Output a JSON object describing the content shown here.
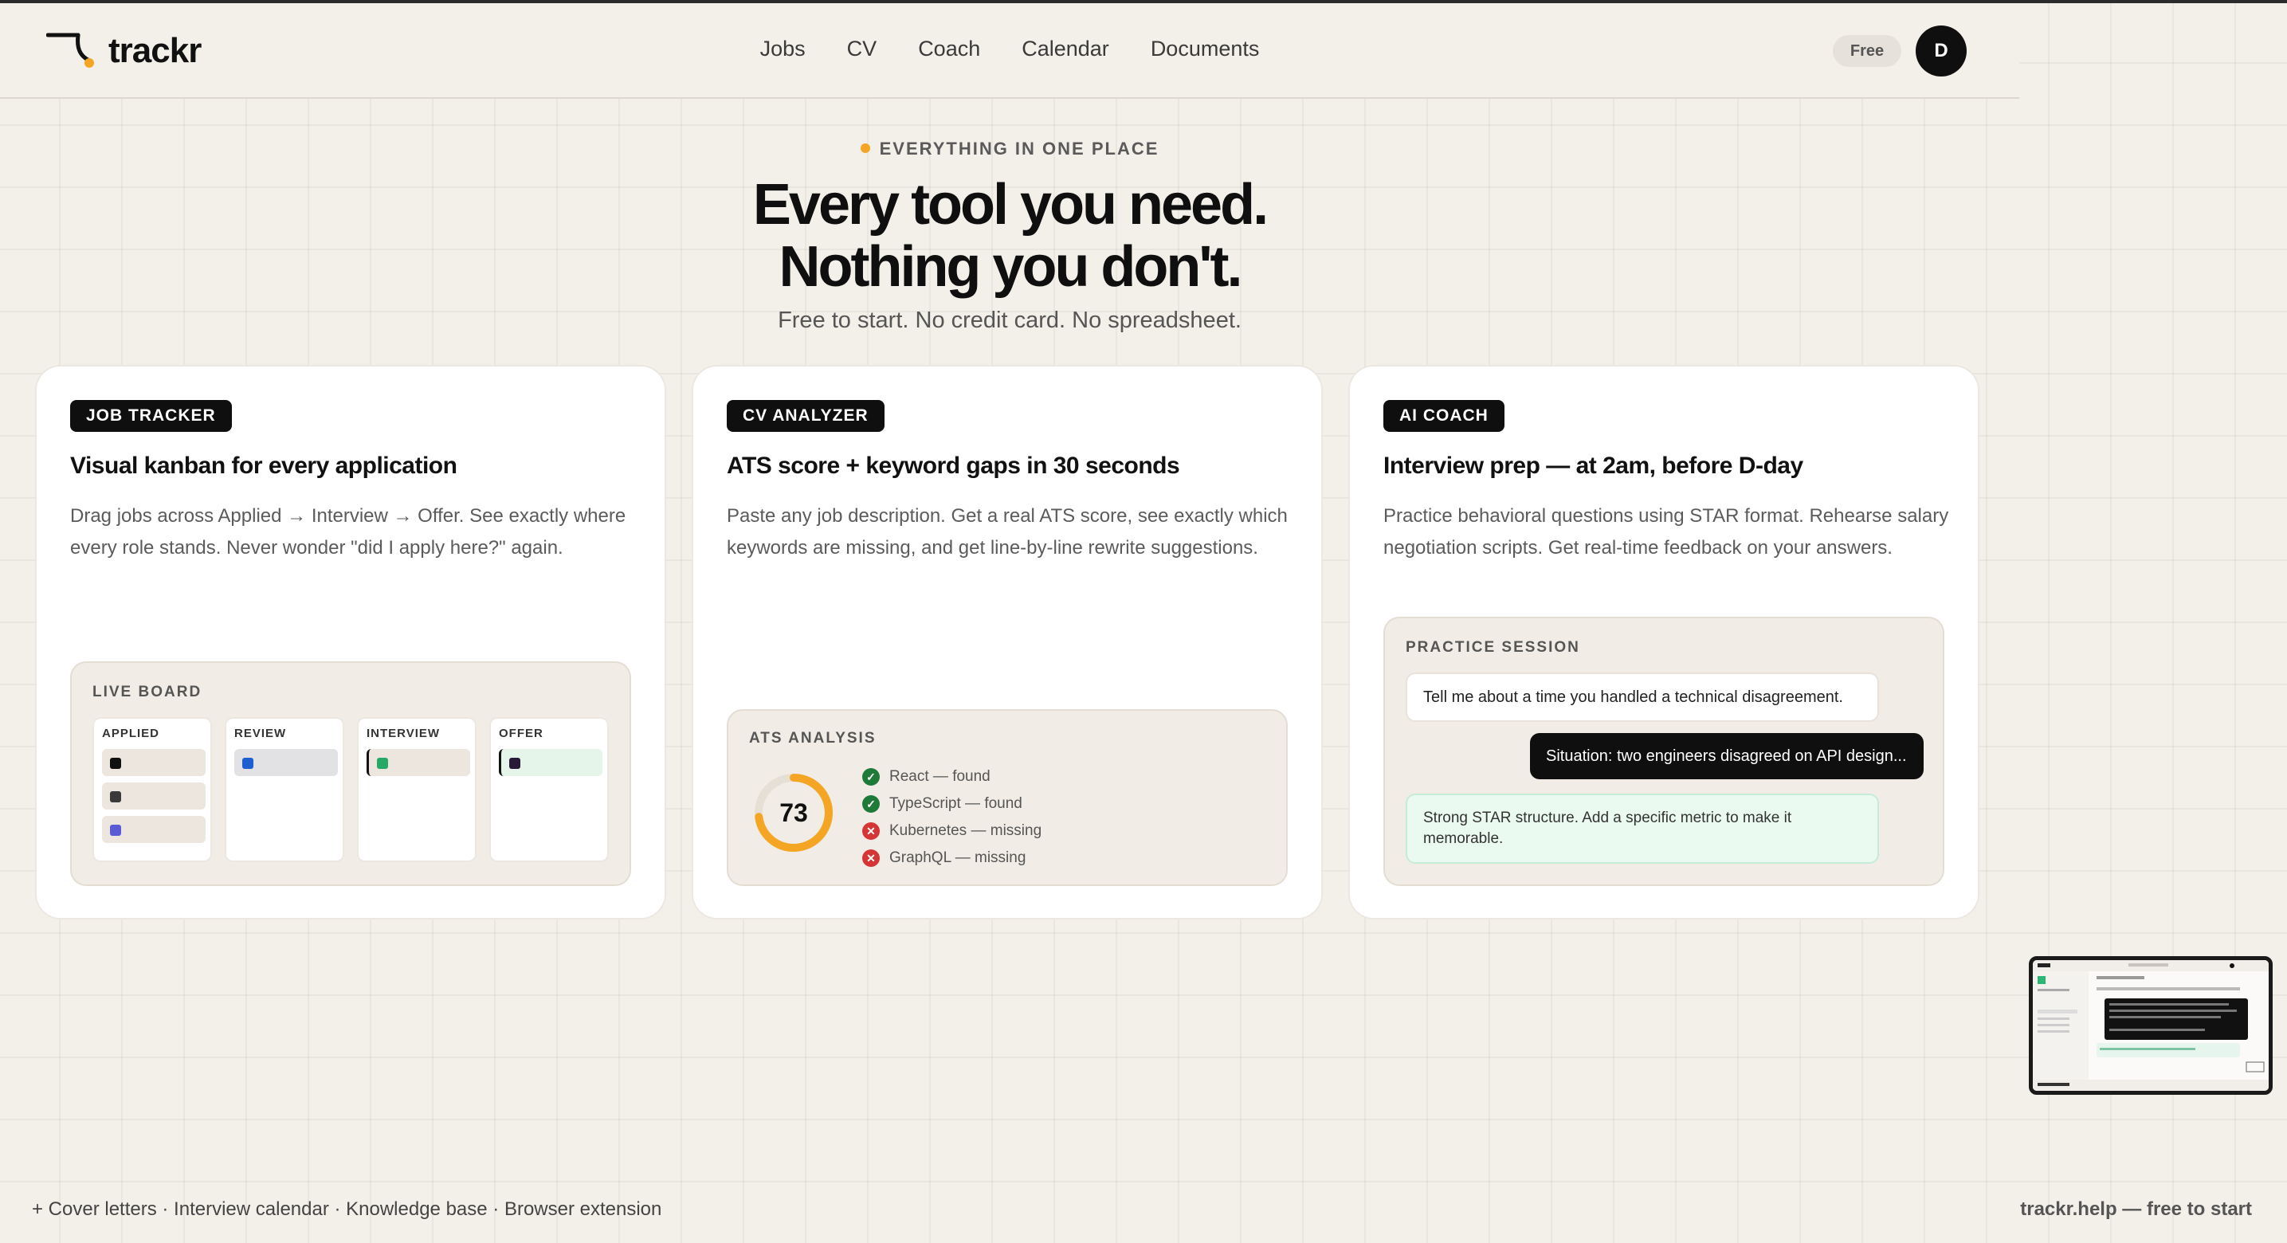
{
  "brand": {
    "name": "trackr"
  },
  "nav": {
    "items": [
      "Jobs",
      "CV",
      "Coach",
      "Calendar",
      "Documents"
    ]
  },
  "account": {
    "plan": "Free",
    "avatar_initial": "D"
  },
  "hero": {
    "eyebrow": "EVERYTHING IN ONE PLACE",
    "title_line1": "Every tool you need.",
    "title_line2": "Nothing you don't.",
    "subtitle": "Free to start. No credit card. No spreadsheet."
  },
  "cards": {
    "tracker": {
      "tag": "JOB TRACKER",
      "title": "Visual kanban for every application",
      "description": "Drag jobs across Applied → Interview → Offer. See exactly where every role stands. Never wonder \"did I apply here?\" again.",
      "panel_label": "LIVE BOARD",
      "columns": [
        "APPLIED",
        "REVIEW",
        "INTERVIEW",
        "OFFER"
      ]
    },
    "cv": {
      "tag": "CV ANALYZER",
      "title": "ATS score + keyword gaps in 30 seconds",
      "description": "Paste any job description. Get a real ATS score, see exactly which keywords are missing, and get line-by-line rewrite suggestions.",
      "panel_label": "ATS ANALYSIS",
      "score": "73",
      "score_fraction": 0.73,
      "keywords": [
        "React — found",
        "TypeScript — found",
        "Kubernetes — missing",
        "GraphQL — missing"
      ]
    },
    "coach": {
      "tag": "AI COACH",
      "title": "Interview prep — at 2am, before D-day",
      "description": "Practice behavioral questions using STAR format. Rehearse salary negotiation scripts. Get real-time feedback on your answers.",
      "panel_label": "PRACTICE SESSION",
      "question": "Tell me about a time you handled a technical disagreement.",
      "answer": "Situation: two engineers disagreed on API design...",
      "feedback": "Strong STAR structure. Add a specific metric to make it memorable."
    }
  },
  "footer": {
    "left": "+ Cover letters · Interview calendar · Knowledge base · Browser extension",
    "right": "trackr.help — free to start"
  },
  "colors": {
    "accent": "#f5a524",
    "found": "#1f7a3a",
    "missing": "#d63535",
    "dark": "#0f0f0f"
  }
}
